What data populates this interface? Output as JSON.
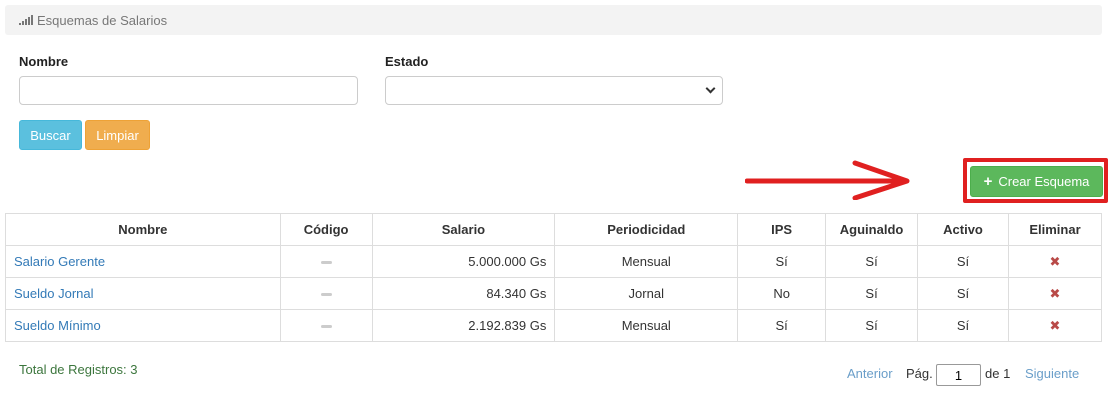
{
  "header": {
    "title": "Esquemas de Salarios",
    "icon": "signal-bars-icon"
  },
  "filters": {
    "nombre_label": "Nombre",
    "nombre_value": "",
    "estado_label": "Estado",
    "estado_value": ""
  },
  "buttons": {
    "buscar": "Buscar",
    "limpiar": "Limpiar",
    "crear": "Crear Esquema",
    "crear_icon": "plus-icon"
  },
  "table": {
    "headers": [
      "Nombre",
      "Código",
      "Salario",
      "Periodicidad",
      "IPS",
      "Aguinaldo",
      "Activo",
      "Eliminar"
    ],
    "rows": [
      {
        "nombre": "Salario Gerente",
        "codigo": "",
        "salario": "5.000.000 Gs",
        "periodicidad": "Mensual",
        "ips": "Sí",
        "aguinaldo": "Sí",
        "activo": "Sí"
      },
      {
        "nombre": "Sueldo Jornal",
        "codigo": "",
        "salario": "84.340 Gs",
        "periodicidad": "Jornal",
        "ips": "No",
        "aguinaldo": "Sí",
        "activo": "Sí"
      },
      {
        "nombre": "Sueldo Mínimo",
        "codigo": "",
        "salario": "2.192.839 Gs",
        "periodicidad": "Mensual",
        "ips": "Sí",
        "aguinaldo": "Sí",
        "activo": "Sí"
      }
    ]
  },
  "footer": {
    "total": "Total de Registros: 3",
    "anterior": "Anterior",
    "pag_label": "Pág.",
    "page_value": "1",
    "of_label": "de 1",
    "siguiente": "Siguiente"
  },
  "colors": {
    "buscar": "#5bc0de",
    "limpiar": "#f0ad4e",
    "crear": "#5cb85c",
    "highlight": "#e02020",
    "link": "#337ab7",
    "delete": "#b94a48"
  }
}
